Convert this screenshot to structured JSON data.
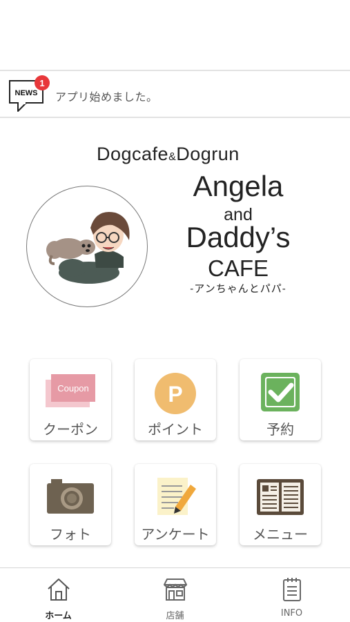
{
  "news": {
    "icon_label": "NEWS",
    "badge_count": "1",
    "message": "アプリ始めました。"
  },
  "logo": {
    "subtitle_a": "Dogcafe",
    "subtitle_amp": "&",
    "subtitle_b": "Dogrun",
    "line1": "Angela",
    "line2": "and",
    "line3": "Daddy’s",
    "line4": "CAFE",
    "line5": "-アンちゃんとパパ-"
  },
  "menu": [
    {
      "label": "クーポン",
      "icon": "coupon-icon",
      "icon_text": "Coupon"
    },
    {
      "label": "ポイント",
      "icon": "point-icon",
      "icon_text": "P"
    },
    {
      "label": "予約",
      "icon": "reservation-icon"
    },
    {
      "label": "フォト",
      "icon": "camera-icon"
    },
    {
      "label": "アンケート",
      "icon": "survey-icon"
    },
    {
      "label": "メニュー",
      "icon": "menu-book-icon"
    }
  ],
  "tabs": [
    {
      "label": "ホーム",
      "icon": "home-icon",
      "active": true
    },
    {
      "label": "店舗",
      "icon": "store-icon",
      "active": false
    },
    {
      "label": "INFO",
      "icon": "info-icon",
      "active": false
    }
  ],
  "colors": {
    "badge": "#e8373a",
    "coupon": "#e69aa5",
    "point": "#f0bc6f",
    "reservation": "#6bb25d",
    "camera": "#6e6251",
    "menu_book": "#5a4a3a"
  }
}
